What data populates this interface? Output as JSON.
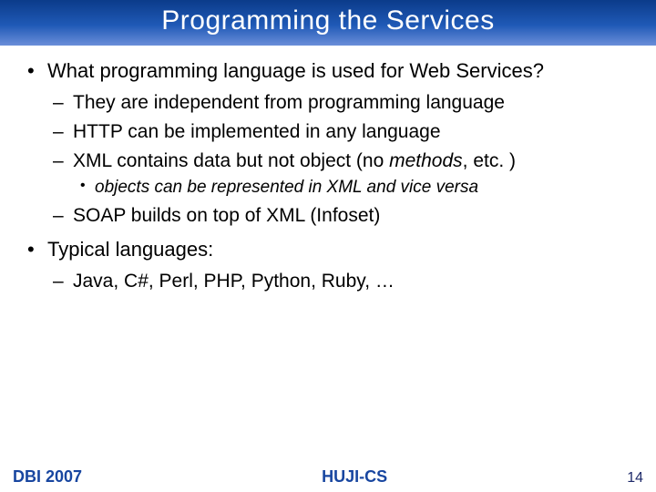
{
  "title": "Programming the Services",
  "bullets": {
    "q1": "What programming language is used for Web Services?",
    "q1_sub": {
      "a": "They are independent from programming language",
      "b": "HTTP can be implemented in any language",
      "c_pre": "XML contains data but not object (no ",
      "c_em": "methods",
      "c_post": ", etc. )",
      "c_sub": "objects can be represented in XML and vice versa",
      "d": "SOAP builds on top of XML (Infoset)"
    },
    "q2": "Typical languages:",
    "q2_sub": {
      "a": "Java, C#, Perl, PHP, Python, Ruby, …"
    }
  },
  "footer": {
    "left": "DBI 2007",
    "center": "HUJI-CS",
    "page": "14"
  }
}
